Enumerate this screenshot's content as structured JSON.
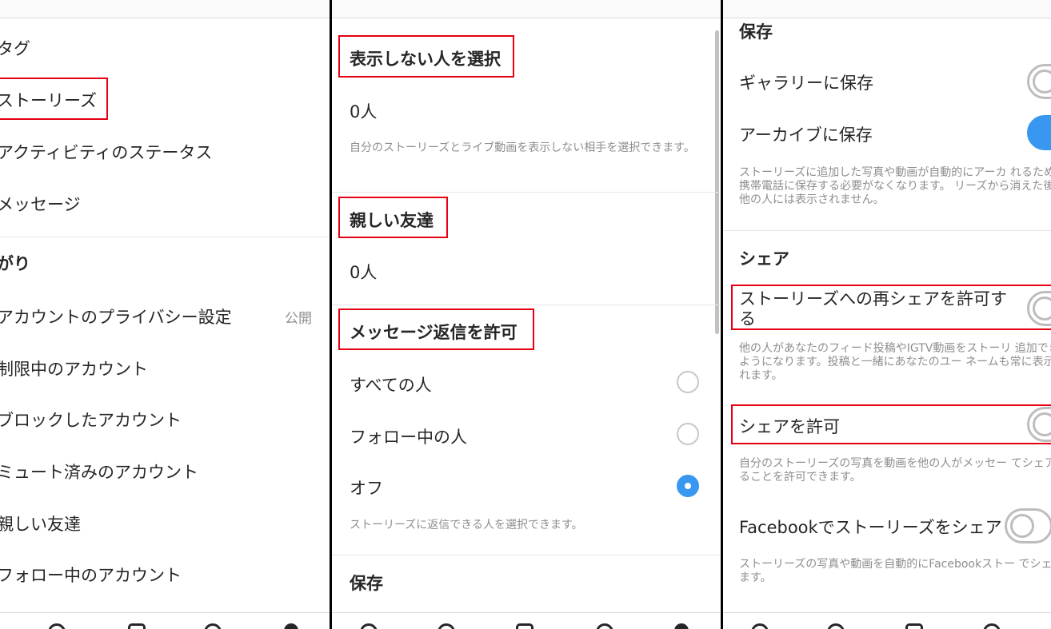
{
  "panel1": {
    "items": [
      {
        "label": "タグ"
      },
      {
        "label": "ストーリーズ"
      },
      {
        "label": "アクティビティのステータス"
      },
      {
        "label": "メッセージ"
      }
    ],
    "section_heading": "がり",
    "privacy": {
      "label": "アカウントのプライバシー設定",
      "value": "公開"
    },
    "items2": [
      {
        "label": "制限中のアカウント"
      },
      {
        "label": "ブロックしたアカウント"
      },
      {
        "label": "ミュート済みのアカウント"
      },
      {
        "label": "親しい友達"
      },
      {
        "label": "フォロー中のアカウント"
      }
    ]
  },
  "panel2": {
    "hide_heading": "表示しない人を選択",
    "hide_count": "0人",
    "hide_desc": "自分のストーリーズとライブ動画を表示しない相手を選択できます。",
    "close_heading": "親しい友達",
    "close_count": "0人",
    "reply_heading": "メッセージ返信を許可",
    "reply_options": [
      {
        "label": "すべての人",
        "selected": false
      },
      {
        "label": "フォロー中の人",
        "selected": false
      },
      {
        "label": "オフ",
        "selected": true
      }
    ],
    "reply_desc": "ストーリーズに返信できる人を選択できます。",
    "save_heading": "保存"
  },
  "panel3": {
    "save_heading": "保存",
    "gallery_label": "ギャラリーに保存",
    "gallery_on": false,
    "archive_label": "アーカイブに保存",
    "archive_on": true,
    "archive_desc": "ストーリーズに追加した写真や動画が自動的にアーカ れるため、携帯電話に保存する必要がなくなります。 リーズから消えた後は他の人には表示されません。",
    "share_heading": "シェア",
    "reshare_label": "ストーリーズへの再シェアを許可する",
    "reshare_on": false,
    "reshare_desc": "他の人があなたのフィード投稿やIGTV動画をストーリ 追加できるようになります。投稿と一緒にあなたのユー ネームも常に表示されます。",
    "allow_share_label": "シェアを許可",
    "allow_share_on": false,
    "allow_share_desc": "自分のストーリーズの写真を動画を他の人がメッセー てシェアすることを許可できます。",
    "facebook_label": "Facebookでストーリーズをシェア",
    "facebook_on": false,
    "facebook_desc": "ストーリーズの写真や動画を自動的にFacebookストー でシェアします。"
  },
  "colors": {
    "accent": "#3897f0",
    "highlight": "#e60012",
    "text": "#262626",
    "muted": "#8e8e8e"
  }
}
